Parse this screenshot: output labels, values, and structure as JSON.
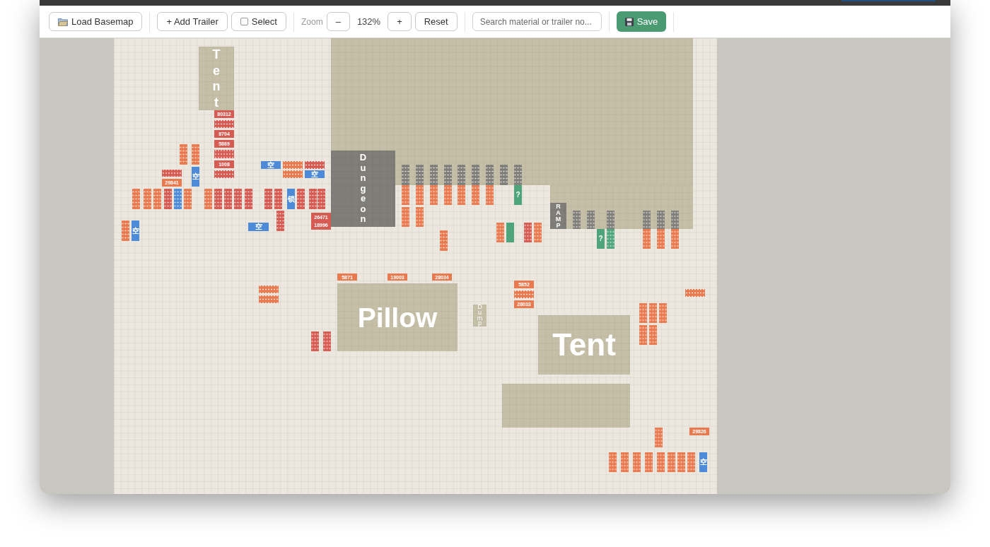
{
  "toolbar": {
    "groups": [
      [
        {
          "kind": "load",
          "label": "Load Basemap"
        }
      ],
      [
        {
          "kind": "button",
          "label": "+ Add Trailer"
        },
        {
          "kind": "toggle",
          "label": "Select",
          "checked": false
        }
      ],
      [
        {
          "kind": "caption",
          "label": "Zoom"
        },
        {
          "kind": "button",
          "label": "–"
        },
        {
          "kind": "readout",
          "label": "132%"
        },
        {
          "kind": "button",
          "label": "+"
        },
        {
          "kind": "button",
          "label": "Reset"
        }
      ],
      [
        {
          "kind": "search",
          "placeholder": "Search material or trailer no..."
        }
      ],
      [
        {
          "kind": "save",
          "label": "Save"
        }
      ]
    ]
  },
  "map": {
    "zones": [
      {
        "kind": "vertical",
        "label": "Tent",
        "color": "#c5bfa8"
      },
      {
        "kind": "blank",
        "color": "#c5bfa8"
      },
      {
        "kind": "blank",
        "color": "#c5bfa8"
      },
      {
        "kind": "vertical",
        "label": "Dungeon",
        "color": "#807e78"
      },
      {
        "kind": "vertical",
        "label": "RAMP",
        "color": "#807e78"
      },
      {
        "kind": "horizontal",
        "label": "Pillow",
        "color": "#c5bfa8"
      },
      {
        "kind": "vertical",
        "label": "Dump",
        "color": "#c5bfa8"
      },
      {
        "kind": "horizontal",
        "label": "Tent",
        "color": "#c5bfa8"
      },
      {
        "kind": "blank",
        "color": "#c5bfa8"
      }
    ],
    "trailers": [
      {
        "kind": "number",
        "label": "80312",
        "color": "#d65b53"
      },
      {
        "kind": "smudge",
        "color": "#d65b53"
      },
      {
        "kind": "number",
        "label": "8704",
        "color": "#d65b53"
      },
      {
        "kind": "number",
        "label": "5869",
        "color": "#d65b53"
      },
      {
        "kind": "smudge",
        "color": "#d65b53"
      },
      {
        "kind": "number",
        "label": "1008",
        "color": "#d65b53"
      },
      {
        "kind": "smudge",
        "color": "#d65b53"
      },
      {
        "kind": "smudge",
        "color": "#e97a4f"
      },
      {
        "kind": "smudge",
        "color": "#e97a4f"
      },
      {
        "kind": "smudge",
        "color": "#d65b53"
      },
      {
        "kind": "glyph",
        "label": "空",
        "color": "#4d8bd8"
      },
      {
        "kind": "number",
        "label": "29841",
        "color": "#e97a4f"
      },
      {
        "kind": "glyph",
        "label": "空",
        "color": "#4d8bd8"
      },
      {
        "kind": "smudge",
        "color": "#e97a4f"
      },
      {
        "kind": "smudge",
        "color": "#d65b53"
      },
      {
        "kind": "smudge",
        "color": "#e97a4f"
      },
      {
        "kind": "glyph",
        "label": "空",
        "color": "#4d8bd8"
      },
      {
        "kind": "smudge",
        "color": "#e97a4f"
      },
      {
        "kind": "smudge",
        "color": "#e97a4f"
      },
      {
        "kind": "smudge",
        "color": "#e97a4f"
      },
      {
        "kind": "smudge",
        "color": "#d65b53"
      },
      {
        "kind": "smudge",
        "color": "#4d8bd8"
      },
      {
        "kind": "smudge",
        "color": "#e97a4f"
      },
      {
        "kind": "smudge",
        "color": "#e97a4f"
      },
      {
        "kind": "smudge",
        "color": "#d65b53"
      },
      {
        "kind": "smudge",
        "color": "#d65b53"
      },
      {
        "kind": "smudge",
        "color": "#d65b53"
      },
      {
        "kind": "smudge",
        "color": "#d65b53"
      },
      {
        "kind": "smudge",
        "color": "#d65b53"
      },
      {
        "kind": "smudge",
        "color": "#d65b53"
      },
      {
        "kind": "glyph",
        "label": "锁",
        "color": "#4d8bd8"
      },
      {
        "kind": "smudge",
        "color": "#d65b53"
      },
      {
        "kind": "smudge",
        "color": "#d65b53"
      },
      {
        "kind": "smudge",
        "color": "#d65b53"
      },
      {
        "kind": "smudge",
        "color": "#d65b53"
      },
      {
        "kind": "number",
        "label": "26471\n18996",
        "color": "#d65b53"
      },
      {
        "kind": "glyph",
        "label": "空",
        "color": "#4d8bd8"
      },
      {
        "kind": "smudge",
        "color": "#e97a4f"
      },
      {
        "kind": "glyph",
        "label": "空",
        "color": "#4d8bd8"
      },
      {
        "kind": "smudge",
        "color": "#807e78"
      },
      {
        "kind": "smudge",
        "color": "#807e78"
      },
      {
        "kind": "smudge",
        "color": "#807e78"
      },
      {
        "kind": "smudge",
        "color": "#807e78"
      },
      {
        "kind": "smudge",
        "color": "#807e78"
      },
      {
        "kind": "smudge",
        "color": "#807e78"
      },
      {
        "kind": "smudge",
        "color": "#807e78"
      },
      {
        "kind": "smudge",
        "color": "#807e78"
      },
      {
        "kind": "smudge",
        "color": "#807e78"
      },
      {
        "kind": "smudge",
        "color": "#e97a4f"
      },
      {
        "kind": "smudge",
        "color": "#e97a4f"
      },
      {
        "kind": "smudge",
        "color": "#e97a4f"
      },
      {
        "kind": "smudge",
        "color": "#e97a4f"
      },
      {
        "kind": "smudge",
        "color": "#e97a4f"
      },
      {
        "kind": "smudge",
        "color": "#e97a4f"
      },
      {
        "kind": "smudge",
        "color": "#e97a4f"
      },
      {
        "kind": "glyph",
        "label": "?",
        "color": "#4ea57c"
      },
      {
        "kind": "smudge",
        "color": "#e97a4f"
      },
      {
        "kind": "smudge",
        "color": "#e97a4f"
      },
      {
        "kind": "smudge",
        "color": "#e97a4f"
      },
      {
        "kind": "smudge",
        "color": "#e97a4f"
      },
      {
        "kind": "plain",
        "color": "#4ea57c"
      },
      {
        "kind": "smudge",
        "color": "#d65b53"
      },
      {
        "kind": "smudge",
        "color": "#e97a4f"
      },
      {
        "kind": "smudge",
        "color": "#807e78"
      },
      {
        "kind": "smudge",
        "color": "#807e78"
      },
      {
        "kind": "smudge",
        "color": "#807e78"
      },
      {
        "kind": "smudge",
        "color": "#807e78"
      },
      {
        "kind": "smudge",
        "color": "#807e78"
      },
      {
        "kind": "smudge",
        "color": "#807e78"
      },
      {
        "kind": "glyph",
        "label": "?",
        "color": "#4ea57c"
      },
      {
        "kind": "smudge",
        "color": "#4ea57c"
      },
      {
        "kind": "smudge",
        "color": "#e97a4f"
      },
      {
        "kind": "smudge",
        "color": "#e97a4f"
      },
      {
        "kind": "smudge",
        "color": "#e97a4f"
      },
      {
        "kind": "number",
        "label": "5871",
        "color": "#e97a4f"
      },
      {
        "kind": "number",
        "label": "19003",
        "color": "#e97a4f"
      },
      {
        "kind": "number",
        "label": "28034",
        "color": "#e97a4f"
      },
      {
        "kind": "number",
        "label": "5852",
        "color": "#e97a4f"
      },
      {
        "kind": "smudge",
        "color": "#e97a4f"
      },
      {
        "kind": "smudge",
        "color": "#e97a4f"
      },
      {
        "kind": "smudge",
        "color": "#e97a4f"
      },
      {
        "kind": "smudge",
        "color": "#e97a4f"
      },
      {
        "kind": "number",
        "label": "28033",
        "color": "#e97a4f"
      },
      {
        "kind": "smudge",
        "color": "#e97a4f"
      },
      {
        "kind": "smudge",
        "color": "#e97a4f"
      },
      {
        "kind": "smudge",
        "color": "#e97a4f"
      },
      {
        "kind": "smudge",
        "color": "#e97a4f"
      },
      {
        "kind": "smudge",
        "color": "#e97a4f"
      },
      {
        "kind": "smudge",
        "color": "#d65b53"
      },
      {
        "kind": "smudge",
        "color": "#d65b53"
      },
      {
        "kind": "smudge",
        "color": "#e97a4f"
      },
      {
        "kind": "number",
        "label": "29826",
        "color": "#e97a4f"
      },
      {
        "kind": "smudge",
        "color": "#e97a4f"
      },
      {
        "kind": "smudge",
        "color": "#e97a4f"
      },
      {
        "kind": "smudge",
        "color": "#e97a4f"
      },
      {
        "kind": "smudge",
        "color": "#e97a4f"
      },
      {
        "kind": "smudge",
        "color": "#e97a4f"
      },
      {
        "kind": "smudge",
        "color": "#e97a4f"
      },
      {
        "kind": "smudge",
        "color": "#e97a4f"
      },
      {
        "kind": "smudge",
        "color": "#e97a4f"
      },
      {
        "kind": "glyph",
        "label": "空",
        "color": "#4d8bd8"
      }
    ]
  }
}
